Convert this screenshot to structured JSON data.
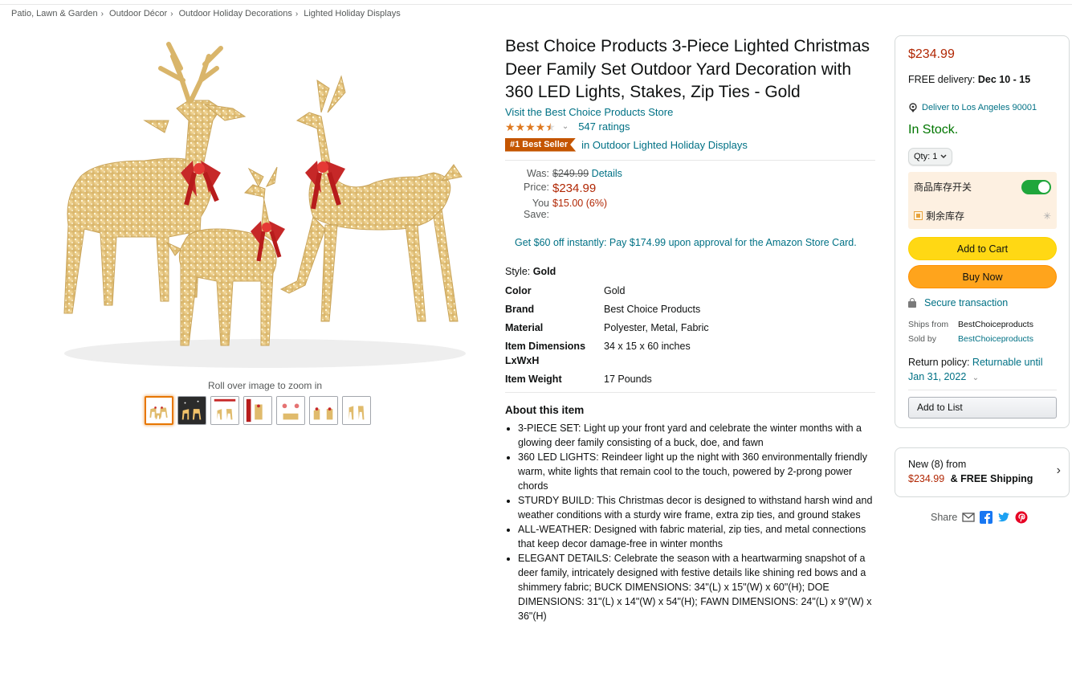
{
  "breadcrumb": [
    "Patio, Lawn & Garden",
    "Outdoor Décor",
    "Outdoor Holiday Decorations",
    "Lighted Holiday Displays"
  ],
  "breadcrumb_sep": "›",
  "gallery": {
    "zoom_hint": "Roll over image to zoom in",
    "thumbnails": 7,
    "active_thumbnail": 1
  },
  "product": {
    "title": "Best Choice Products 3-Piece Lighted Christmas Deer Family Set Outdoor Yard Decoration with 360 LED Lights, Stakes, Zip Ties - Gold",
    "store_link": "Visit the Best Choice Products Store",
    "rating_stars": 4.5,
    "ratings_count": "547 ratings",
    "badge": "#1 Best Seller",
    "badge_category": "in Outdoor Lighted Holiday Displays"
  },
  "price": {
    "was_label": "Was:",
    "was_value": "$249.99",
    "details_link": "Details",
    "price_label": "Price:",
    "price_value": "$234.99",
    "save_label": "You Save:",
    "save_value": "$15.00 (6%)"
  },
  "promo": "Get $60 off instantly: Pay $174.99 upon approval for the Amazon Store Card.",
  "style": {
    "label": "Style:",
    "value": "Gold"
  },
  "specs": [
    {
      "key": "Color",
      "value": "Gold"
    },
    {
      "key": "Brand",
      "value": "Best Choice Products"
    },
    {
      "key": "Material",
      "value": "Polyester, Metal, Fabric"
    },
    {
      "key": "Item Dimensions LxWxH",
      "value": "34 x 15 x 60 inches"
    },
    {
      "key": "Item Weight",
      "value": "17 Pounds"
    }
  ],
  "about": {
    "heading": "About this item",
    "bullets": [
      "3-PIECE SET: Light up your front yard and celebrate the winter months with a glowing deer family consisting of a buck, doe, and fawn",
      "360 LED LIGHTS: Reindeer light up the night with 360 environmentally friendly warm, white lights that remain cool to the touch, powered by 2-prong power chords",
      "STURDY BUILD: This Christmas decor is designed to withstand harsh wind and weather conditions with a sturdy wire frame, extra zip ties, and ground stakes",
      "ALL-WEATHER: Designed with fabric material, zip ties, and metal connections that keep decor damage-free in winter months",
      "ELEGANT DETAILS: Celebrate the season with a heartwarming snapshot of a deer family, intricately designed with festive details like shining red bows and a shimmery fabric; BUCK DIMENSIONS: 34\"(L) x 15\"(W) x 60\"(H); DOE DIMENSIONS: 31\"(L) x 14\"(W) x 54\"(H); FAWN DIMENSIONS: 24\"(L) x 9\"(W) x 36\"(H)"
    ]
  },
  "buybox": {
    "price": "$234.99",
    "delivery_prefix": "FREE delivery:",
    "delivery_dates": "Dec 10 - 15",
    "deliver_to": "Deliver to Los Angeles 90001",
    "stock": "In Stock.",
    "qty": "Qty: 1",
    "ext_label_1": "商品库存开关",
    "ext_label_2": "剩余库存",
    "ext_toggle_on": true,
    "add_to_cart": "Add to Cart",
    "buy_now": "Buy Now",
    "secure": "Secure transaction",
    "ships_from_label": "Ships from",
    "ships_from_value": "BestChoiceproducts",
    "sold_by_label": "Sold by",
    "sold_by_value": "BestChoiceproducts",
    "return_label": "Return policy:",
    "return_link": "Returnable until Jan 31, 2022",
    "add_to_list": "Add to List"
  },
  "new_offers": {
    "line1": "New (8) from",
    "price": "$234.99",
    "shipping": "& FREE Shipping"
  },
  "share": {
    "label": "Share"
  },
  "colors": {
    "link": "#007185",
    "price": "#b12704",
    "stock": "#007600",
    "badge": "#c45500",
    "star": "#de7921"
  }
}
